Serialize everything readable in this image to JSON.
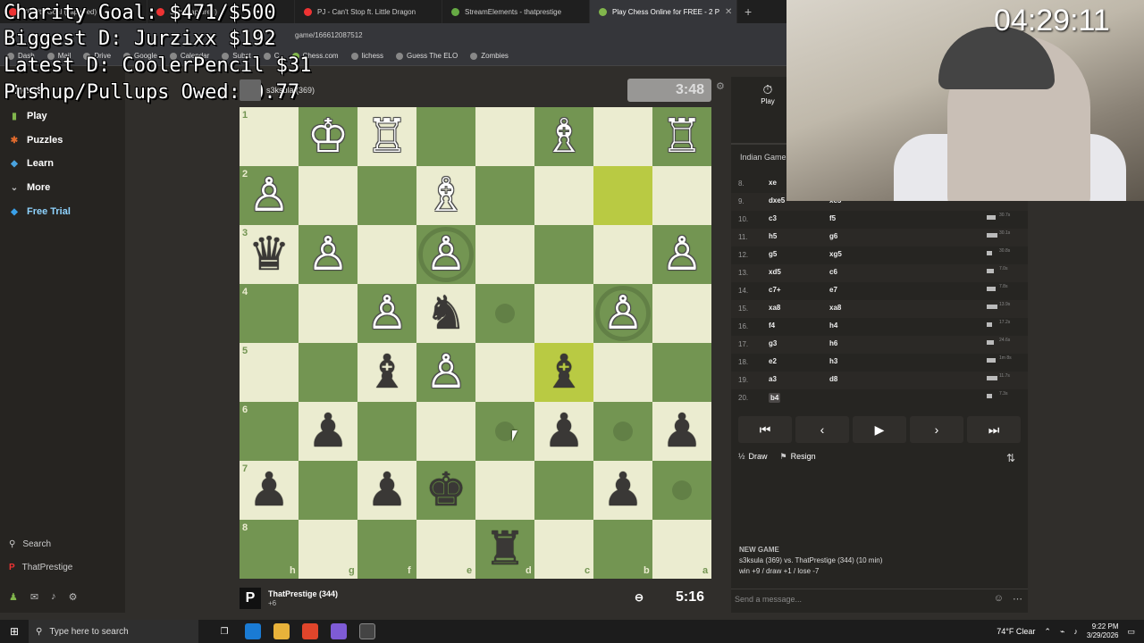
{
  "browser": {
    "tabs": [
      {
        "label": "Charity Goal (captured)"
      },
      {
        "label": "Sub (captured)"
      },
      {
        "label": "PJ - Can't Stop ft. Little Dragon"
      },
      {
        "label": "StreamElements - thatprestige"
      },
      {
        "label": "Play Chess Online for FREE - 2 P"
      }
    ],
    "new_tab": "+",
    "address": "game/166612087512",
    "bookmarks": [
      "Dash",
      "Mail",
      "Drive",
      "Google",
      "Calendar",
      "Subst",
      "C",
      "Chess.com",
      "lichess",
      "Guess The ELO",
      "Zombies"
    ]
  },
  "overlay": {
    "line1": "Charity Goal: $471/$500",
    "line2": "Biggest D: Jurzixx $192",
    "line3": "Latest D: CoolerPencil $31",
    "line4": "Pushup/Pullups Owed: 0.77"
  },
  "sidenav": {
    "logo": "Chess",
    "items": [
      {
        "label": "Play",
        "icon": "play-icon",
        "color": "#81b64c"
      },
      {
        "label": "Puzzles",
        "icon": "puzzle-icon",
        "color": "#e06a2d"
      },
      {
        "label": "Learn",
        "icon": "learn-icon",
        "color": "#4aa3df"
      },
      {
        "label": "More",
        "icon": "chevron-down-icon",
        "color": "#bbbbbb"
      },
      {
        "label": "Free Trial",
        "icon": "diamond-icon",
        "color": "#3aa0e8"
      }
    ],
    "search": "Search",
    "account": "ThatPrestige"
  },
  "game": {
    "top_player": "s3ksula (369)",
    "top_clock": "3:48",
    "bottom_player": "ThatPrestige (344)",
    "bottom_sub": "+6",
    "bottom_clock": "5:16",
    "rank_labels": [
      "1",
      "2",
      "3",
      "4",
      "5",
      "6",
      "7",
      "8"
    ],
    "file_labels": [
      "h",
      "g",
      "f",
      "e",
      "d",
      "c",
      "b",
      "a"
    ],
    "pieces": [
      {
        "sq": "g1",
        "p": "♔",
        "c": "w"
      },
      {
        "sq": "f1",
        "p": "♖",
        "c": "w"
      },
      {
        "sq": "c1",
        "p": "♗",
        "c": "w"
      },
      {
        "sq": "a1",
        "p": "♖",
        "c": "w"
      },
      {
        "sq": "h2",
        "p": "♙",
        "c": "w"
      },
      {
        "sq": "e2",
        "p": "♗",
        "c": "w"
      },
      {
        "sq": "h3",
        "p": "♛",
        "c": "b"
      },
      {
        "sq": "g3",
        "p": "♙",
        "c": "w"
      },
      {
        "sq": "e3",
        "p": "♙",
        "c": "w"
      },
      {
        "sq": "a3",
        "p": "♙",
        "c": "w"
      },
      {
        "sq": "f4",
        "p": "♙",
        "c": "w"
      },
      {
        "sq": "e4",
        "p": "♞",
        "c": "b"
      },
      {
        "sq": "b4",
        "p": "♙",
        "c": "w"
      },
      {
        "sq": "f5",
        "p": "♝",
        "c": "b"
      },
      {
        "sq": "e5",
        "p": "♙",
        "c": "w"
      },
      {
        "sq": "c5",
        "p": "♝",
        "c": "b"
      },
      {
        "sq": "g6",
        "p": "♟",
        "c": "b"
      },
      {
        "sq": "c6",
        "p": "♟",
        "c": "b"
      },
      {
        "sq": "a6",
        "p": "♟",
        "c": "b"
      },
      {
        "sq": "h7",
        "p": "♟",
        "c": "b"
      },
      {
        "sq": "f7",
        "p": "♟",
        "c": "b"
      },
      {
        "sq": "e7",
        "p": "♚",
        "c": "b"
      },
      {
        "sq": "b7",
        "p": "♟",
        "c": "b"
      },
      {
        "sq": "d8",
        "p": "♜",
        "c": "b"
      }
    ],
    "highlights": [
      "b2",
      "c5"
    ],
    "hints": [
      "d4",
      "d6",
      "b6",
      "a7"
    ],
    "capture_rings": [
      "e3",
      "b4"
    ]
  },
  "panel": {
    "play_label": "Play",
    "opening": "Indian Game:",
    "moves": [
      {
        "n": "8.",
        "w": "xe",
        "b": "",
        "t": ""
      },
      {
        "n": "9.",
        "w": "dxe5",
        "b": "xc5",
        "t": ""
      },
      {
        "n": "10.",
        "w": "c3",
        "b": "f5",
        "t": "30.7s"
      },
      {
        "n": "11.",
        "w": "h5",
        "b": "g6",
        "t": "30.1s"
      },
      {
        "n": "12.",
        "w": "g5",
        "b": "xg5",
        "t": "30.8s"
      },
      {
        "n": "13.",
        "w": "xd5",
        "b": "c6",
        "t": "7.0s"
      },
      {
        "n": "14.",
        "w": "c7+",
        "b": "e7",
        "t": "7.8s"
      },
      {
        "n": "15.",
        "w": "xa8",
        "b": "xa8",
        "t": "13.9s"
      },
      {
        "n": "16.",
        "w": "f4",
        "b": "h4",
        "t": "17.2s"
      },
      {
        "n": "17.",
        "w": "g3",
        "b": "h6",
        "t": "24.6s"
      },
      {
        "n": "18.",
        "w": "e2",
        "b": "h3",
        "t": "1m 8s"
      },
      {
        "n": "19.",
        "w": "a3",
        "b": "d8",
        "t": "11.7s"
      },
      {
        "n": "20.",
        "w": "b4",
        "b": "",
        "t": "7.3s"
      }
    ],
    "draw": "Draw",
    "resign": "Resign",
    "new_game_title": "NEW GAME",
    "new_game_line1": "s3ksula (369) vs. ThatPrestige (344) (10 min)",
    "new_game_line2": "win +9 / draw +1 / lose -7",
    "message_placeholder": "Send a message..."
  },
  "stream_time": "04:29:11",
  "taskbar": {
    "search": "Type here to search",
    "weather": "74°F Clear",
    "time": "9:22 PM",
    "date": "3/29/2026"
  }
}
